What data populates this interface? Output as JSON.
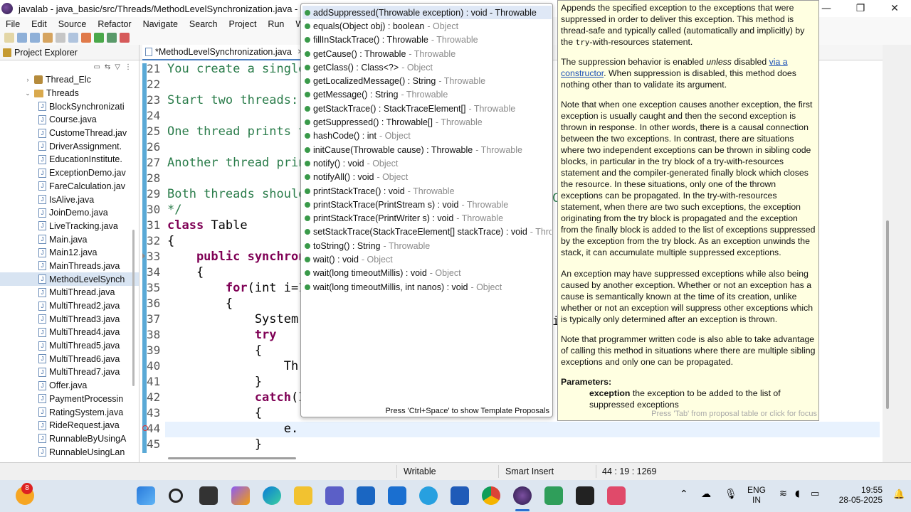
{
  "window": {
    "title": "javalab - java_basic/src/Threads/MethodLevelSynchronization.java - Eclipse",
    "minimize": "—",
    "maximize": "❐",
    "close": "✕"
  },
  "menu": [
    "File",
    "Edit",
    "Source",
    "Refactor",
    "Navigate",
    "Search",
    "Project",
    "Run",
    "Window"
  ],
  "explorer": {
    "tab_label": "Project Explorer",
    "items": [
      {
        "label": "Thread_Elc",
        "type": "package",
        "expanded": false
      },
      {
        "label": "Threads",
        "type": "folder",
        "expanded": true
      },
      {
        "label": "BlockSynchronizati",
        "type": "java"
      },
      {
        "label": "Course.java",
        "type": "java"
      },
      {
        "label": "CustomeThread.jav",
        "type": "java"
      },
      {
        "label": "DriverAssignment.",
        "type": "java"
      },
      {
        "label": "EducationInstitute.",
        "type": "java"
      },
      {
        "label": "ExceptionDemo.jav",
        "type": "java"
      },
      {
        "label": "FareCalculation.jav",
        "type": "java"
      },
      {
        "label": "IsAlive.java",
        "type": "java"
      },
      {
        "label": "JoinDemo.java",
        "type": "java"
      },
      {
        "label": "LiveTracking.java",
        "type": "java"
      },
      {
        "label": "Main.java",
        "type": "java"
      },
      {
        "label": "Main12.java",
        "type": "java"
      },
      {
        "label": "MainThreads.java",
        "type": "java"
      },
      {
        "label": "MethodLevelSynch",
        "type": "java",
        "selected": true
      },
      {
        "label": "MultiThread.java",
        "type": "java"
      },
      {
        "label": "MultiThread2.java",
        "type": "java"
      },
      {
        "label": "MultiThread3.java",
        "type": "java"
      },
      {
        "label": "MultiThread4.java",
        "type": "java"
      },
      {
        "label": "MultiThread5.java",
        "type": "java"
      },
      {
        "label": "MultiThread6.java",
        "type": "java"
      },
      {
        "label": "MultiThread7.java",
        "type": "java"
      },
      {
        "label": "Offer.java",
        "type": "java"
      },
      {
        "label": "PaymentProcessin",
        "type": "java"
      },
      {
        "label": "RatingSystem.java",
        "type": "java"
      },
      {
        "label": "RideRequest.java",
        "type": "java"
      },
      {
        "label": "RunnableByUsingA",
        "type": "java"
      },
      {
        "label": "RunnableUsingLan",
        "type": "java"
      }
    ]
  },
  "editor": {
    "tab_label": "*MethodLevelSynchronization.java",
    "tab_close": "✕",
    "lines": [
      {
        "n": "21",
        "text": "You create a single",
        "style": "comment"
      },
      {
        "n": "22",
        "text": "",
        "style": "comment"
      },
      {
        "n": "23",
        "text": "Start two threads:",
        "style": "comment"
      },
      {
        "n": "24",
        "text": "",
        "style": "comment"
      },
      {
        "n": "25",
        "text": "One thread prints t",
        "style": "comment"
      },
      {
        "n": "26",
        "text": "",
        "style": "comment"
      },
      {
        "n": "27",
        "text": "Another thread prin",
        "style": "comment"
      },
      {
        "n": "28",
        "text": "",
        "style": "comment"
      },
      {
        "n": "29",
        "text": "Both threads should",
        "style": "comment"
      },
      {
        "n": "30",
        "text": "*/",
        "style": "comment"
      },
      {
        "n": "31",
        "kw": "class",
        "text": " Table",
        "style": "code"
      },
      {
        "n": "32",
        "text": "{",
        "style": "code"
      },
      {
        "n": "33",
        "kw": "    public synchron",
        "text": "",
        "style": "code"
      },
      {
        "n": "34",
        "text": "    {",
        "style": "code"
      },
      {
        "n": "35",
        "kw": "        for",
        "text": "(int i=1",
        "style": "code"
      },
      {
        "n": "36",
        "text": "        {",
        "style": "code"
      },
      {
        "n": "37",
        "text": "            System.",
        "style": "code"
      },
      {
        "n": "38",
        "kw": "            try",
        "text": "",
        "style": "code"
      },
      {
        "n": "39",
        "text": "            {",
        "style": "code"
      },
      {
        "n": "40",
        "text": "                Thr",
        "style": "code"
      },
      {
        "n": "41",
        "text": "            }",
        "style": "code"
      },
      {
        "n": "42",
        "kw": "            catch",
        "text": "(I",
        "style": "code"
      },
      {
        "n": "43",
        "text": "            {",
        "style": "code"
      },
      {
        "n": "44",
        "text": "                e.",
        "style": "code"
      },
      {
        "n": "45",
        "text": "            }",
        "style": "code"
      }
    ],
    "hidden_fragments": [
      "C",
      "i"
    ]
  },
  "completion": {
    "items": [
      {
        "sig": "addSuppressed(Throwable exception) : void - Throwable",
        "owner": ""
      },
      {
        "sig": "equals(Object obj) : boolean",
        "owner": "- Object"
      },
      {
        "sig": "fillInStackTrace() : Throwable",
        "owner": "- Throwable"
      },
      {
        "sig": "getCause() : Throwable",
        "owner": "- Throwable"
      },
      {
        "sig": "getClass() : Class<?>",
        "owner": "- Object"
      },
      {
        "sig": "getLocalizedMessage() : String",
        "owner": "- Throwable"
      },
      {
        "sig": "getMessage() : String",
        "owner": "- Throwable"
      },
      {
        "sig": "getStackTrace() : StackTraceElement[]",
        "owner": "- Throwable"
      },
      {
        "sig": "getSuppressed() : Throwable[]",
        "owner": "- Throwable"
      },
      {
        "sig": "hashCode() : int",
        "owner": "- Object"
      },
      {
        "sig": "initCause(Throwable cause) : Throwable",
        "owner": "- Throwable"
      },
      {
        "sig": "notify() : void",
        "owner": "- Object"
      },
      {
        "sig": "notifyAll() : void",
        "owner": "- Object"
      },
      {
        "sig": "printStackTrace() : void",
        "owner": "- Throwable"
      },
      {
        "sig": "printStackTrace(PrintStream s) : void",
        "owner": "- Throwable"
      },
      {
        "sig": "printStackTrace(PrintWriter s) : void",
        "owner": "- Throwable"
      },
      {
        "sig": "setStackTrace(StackTraceElement[] stackTrace) : void",
        "owner": "- Throwable"
      },
      {
        "sig": "toString() : String",
        "owner": "- Throwable"
      },
      {
        "sig": "wait() : void",
        "owner": "- Object"
      },
      {
        "sig": "wait(long timeoutMillis) : void",
        "owner": "- Object"
      },
      {
        "sig": "wait(long timeoutMillis, int nanos) : void",
        "owner": "- Object"
      }
    ],
    "hint": "Press 'Ctrl+Space' to show Template Proposals"
  },
  "javadoc": {
    "p1": "Appends the specified exception to the exceptions that were suppressed in order to deliver this exception. This method is thread-safe and typically called (automatically and implicitly) by the",
    "p1_code": "try",
    "p1_tail": "-with-resources statement.",
    "p2_a": "The suppression behavior is enabled",
    "p2_em": "unless",
    "p2_b": "disabled",
    "p2_link": "via a constructor",
    "p2_c": ". When suppression is disabled, this method does nothing other than to validate its argument.",
    "p3": "Note that when one exception causes another exception, the first exception is usually caught and then the second exception is thrown in response. In other words, there is a causal connection between the two exceptions. In contrast, there are situations where two independent exceptions can be thrown in sibling code blocks, in particular in the try block of a try-with-resources statement and the compiler-generated finally block which closes the resource. In these situations, only one of the thrown exceptions can be propagated. In the try-with-resources statement, when there are two such exceptions, the exception originating from the try block is propagated and the exception from the finally block is added to the list of exceptions suppressed by the exception from the try block. As an exception unwinds the stack, it can accumulate multiple suppressed exceptions.",
    "p4": "An exception may have suppressed exceptions while also being caused by another exception. Whether or not an exception has a cause is semantically known at the time of its creation, unlike whether or not an exception will suppress other exceptions which is typically only determined after an exception is thrown.",
    "p5": "Note that programmer written code is also able to take advantage of calling this method in situations where there are multiple sibling exceptions and only one can be propagated.",
    "params_heading": "Parameters:",
    "param_name": "exception",
    "param_desc": "the exception to be added to the list of suppressed exceptions",
    "footer": "Press 'Tab' from proposal table or click for focus"
  },
  "status": {
    "writable": "Writable",
    "insert_mode": "Smart Insert",
    "position": "44 : 19 : 1269"
  },
  "taskbar": {
    "badge": "8",
    "lang_top": "ENG",
    "lang_bottom": "IN",
    "time": "19:55",
    "date": "28-05-2025"
  }
}
